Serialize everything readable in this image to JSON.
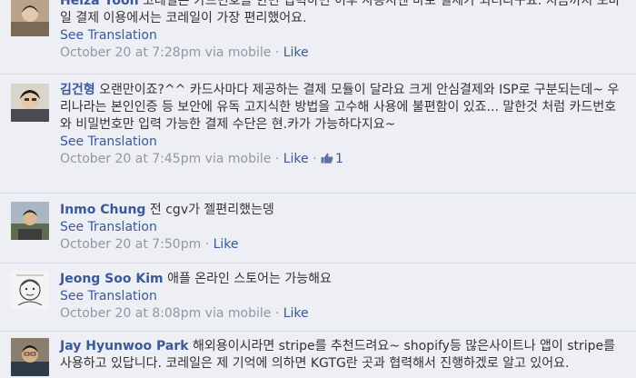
{
  "comments": [
    {
      "name": "Heiza Yoon",
      "text": "코레일은 카드번호를 한번 입력하면 이후 사용시엔 바로 결제가 되더라구요. 지금까지 모바일 결제 이용에서는 코레일이 가장 편리했어요.",
      "see_translation": "See Translation",
      "timestamp": "October 20 at 7:28pm via mobile",
      "sep": "·",
      "like": "Like"
    },
    {
      "name": "김건형",
      "text": "오랜만이죠?^^ 카드사마다 제공하는 결제 모듈이 달라요 크게 안심결제와 ISP로 구분되는데~ 우리나라는 본인인증 등 보안에 유독 고지식한 방법을 고수해 사용에 불편함이 있죠... 말한것 처럼 카드번호와 비밀번호만 입력 가능한 결제 수단은 현.카가 가능하다지요~",
      "see_translation": "See Translation",
      "timestamp": "October 20 at 7:45pm via mobile",
      "sep": "·",
      "like": "Like",
      "like_count": "1"
    },
    {
      "name": "Inmo Chung",
      "text": "전 cgv가 젤편리했는뎅",
      "see_translation": "See Translation",
      "timestamp": "October 20 at 7:50pm",
      "sep": "·",
      "like": "Like"
    },
    {
      "name": "Jeong Soo Kim",
      "text": "애플 온라인 스토어는 가능해요",
      "see_translation": "See Translation",
      "timestamp": "October 20 at 8:08pm via mobile",
      "sep": "·",
      "like": "Like"
    },
    {
      "name": "Jay Hyunwoo Park",
      "text": "해외용이시라면 stripe를 추천드려요~ shopify등 많은사이트나 앱이 stripe를 사용하고 있답니다. 코레일은 제 기억에 의하면 KGTG란 곳과 협력해서 진행하겠로 알고 있어요."
    }
  ],
  "icons": {
    "like_count_icon": "thumbs-up-icon"
  },
  "colors": {
    "link": "#3b5998",
    "meta": "#9197a3",
    "background": "#edeff4"
  }
}
